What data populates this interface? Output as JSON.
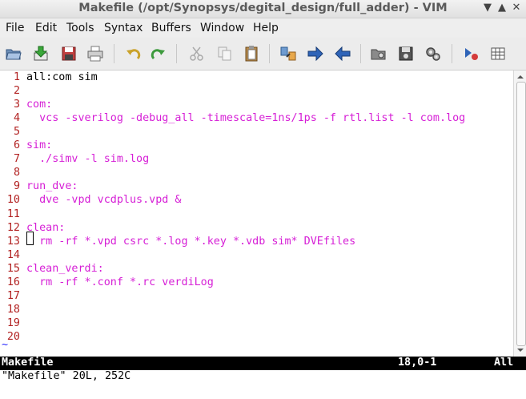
{
  "window": {
    "title": "Makefile (/opt/Synopsys/degital_design/full_adder) - VIM",
    "buttons": [
      "▲",
      "▼",
      "✕"
    ]
  },
  "menu": [
    "File",
    "Edit",
    "Tools",
    "Syntax",
    "Buffers",
    "Window",
    "Help"
  ],
  "toolbar": [
    "open-icon",
    "save-download-icon",
    "save-icon",
    "print-icon",
    "undo-icon",
    "redo-icon",
    "cut-icon",
    "copy-icon",
    "paste-icon",
    "find-replace-icon",
    "forward-arrow-icon",
    "back-arrow-icon",
    "session-load-icon",
    "session-save-icon",
    "make-icon",
    "run-script-icon",
    "table-icon"
  ],
  "editor": {
    "lines": [
      {
        "num": "1",
        "text": "all:com sim",
        "plain": true
      },
      {
        "num": "2",
        "text": ""
      },
      {
        "num": "3",
        "text": "com:"
      },
      {
        "num": "4",
        "text": "  vcs -sverilog -debug_all -timescale=1ns/1ps -f rtl.list -l com.log"
      },
      {
        "num": "5",
        "text": ""
      },
      {
        "num": "6",
        "text": "sim:"
      },
      {
        "num": "7",
        "text": "  ./simv -l sim.log"
      },
      {
        "num": "8",
        "text": ""
      },
      {
        "num": "9",
        "text": "run_dve:"
      },
      {
        "num": "10",
        "text": "  dve -vpd vcdplus.vpd &"
      },
      {
        "num": "11",
        "text": ""
      },
      {
        "num": "12",
        "text": "clean:"
      },
      {
        "num": "13",
        "text": "  rm -rf *.vpd csrc *.log *.key *.vdb sim* DVEfiles"
      },
      {
        "num": "14",
        "text": ""
      },
      {
        "num": "15",
        "text": "clean_verdi:"
      },
      {
        "num": "16",
        "text": "  rm -rf *.conf *.rc verdiLog"
      },
      {
        "num": "17",
        "text": ""
      },
      {
        "num": "18",
        "text": ""
      },
      {
        "num": "19",
        "text": ""
      },
      {
        "num": "20",
        "text": ""
      }
    ],
    "tilde": "~"
  },
  "statusline": {
    "filename": "Makefile",
    "position": "18,0-1",
    "scroll": "All"
  },
  "cmdline": "\"Makefile\" 20L, 252C"
}
